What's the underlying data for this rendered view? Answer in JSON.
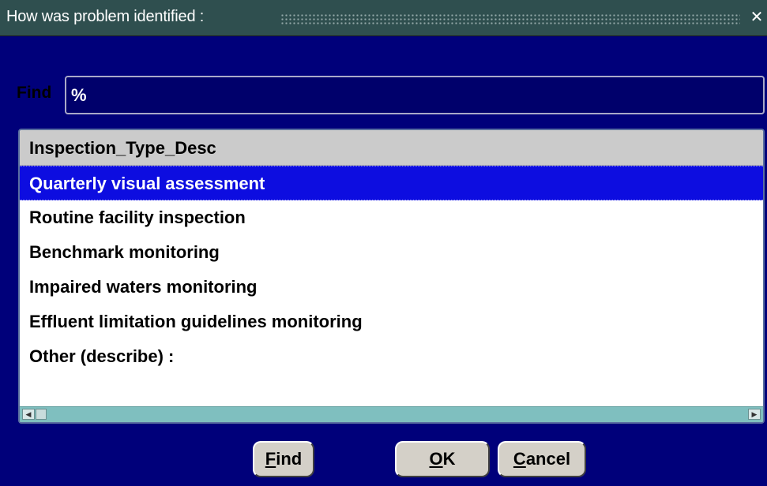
{
  "window": {
    "title": "How was problem identified :"
  },
  "find": {
    "label": "Find",
    "value": "%"
  },
  "list": {
    "header": "Inspection_Type_Desc",
    "items": [
      {
        "label": "Quarterly visual assessment",
        "selected": true
      },
      {
        "label": "Routine facility inspection",
        "selected": false
      },
      {
        "label": "Benchmark monitoring",
        "selected": false
      },
      {
        "label": "Impaired waters monitoring",
        "selected": false
      },
      {
        "label": "Effluent limitation guidelines monitoring",
        "selected": false
      },
      {
        "label": "Other (describe) :",
        "selected": false
      }
    ]
  },
  "buttons": {
    "find": {
      "mnemonic": "F",
      "rest": "ind"
    },
    "ok": {
      "mnemonic": "O",
      "rest": "K"
    },
    "cancel": {
      "mnemonic": "C",
      "rest": "ancel"
    }
  },
  "colors": {
    "background": "#00007a",
    "selection": "#0d0de0",
    "titlebar": "#2f4f4f",
    "scrollbar": "#7fbfbf"
  }
}
